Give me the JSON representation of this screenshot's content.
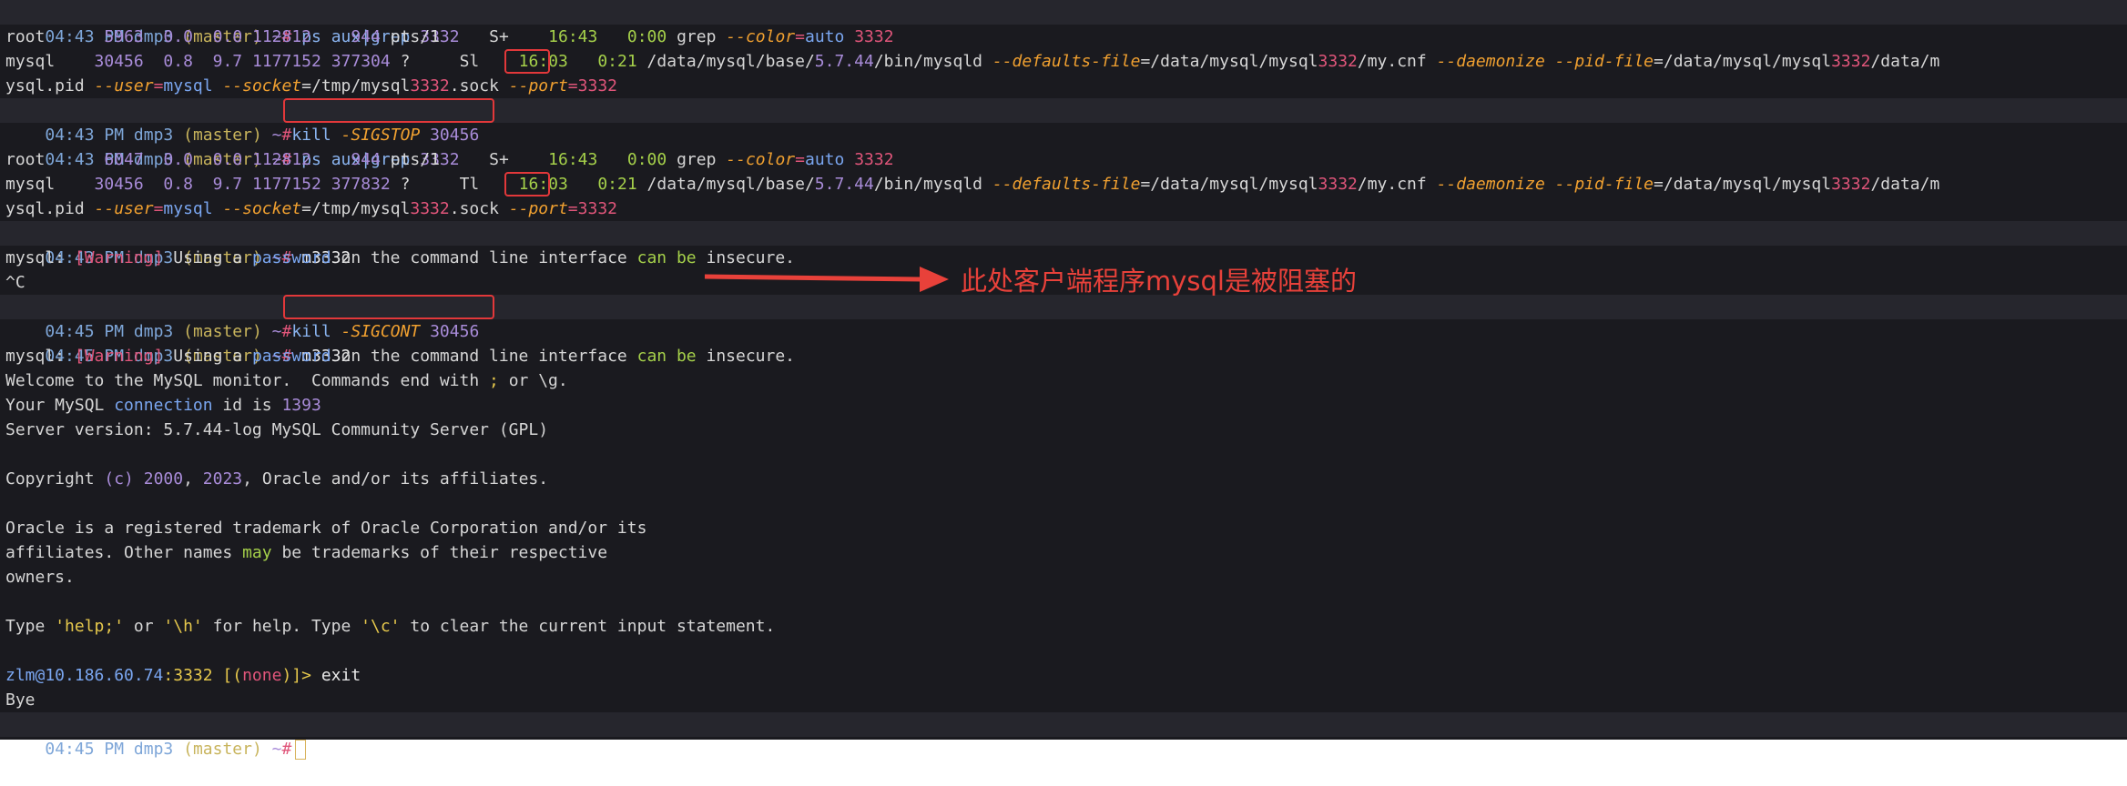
{
  "prompt": {
    "time1": "04:43 PM",
    "time2": "04:45 PM",
    "host": "dmp3",
    "branch": "(master)",
    "tilde": "~",
    "hash": "#"
  },
  "lines": {
    "l1_cmd": "ps aux|grep",
    "l1_arg": "3332",
    "l2": {
      "user": "root",
      "pid": "5963",
      "cpu": "0.0",
      "mem": "0.0",
      "vsz": "112812",
      "rss": "944",
      "tty": "pts/1",
      "stat": "S+",
      "start": "16:43",
      "time": "0:00",
      "cmd": "grep",
      "opt": "--color",
      "eq": "=",
      "val": "auto",
      "arg": "3332"
    },
    "l3": {
      "user": "mysql",
      "pid": "30456",
      "cpu": "0.8",
      "mem": "9.7",
      "vsz": "1177152",
      "rss": "377304",
      "tty": "?",
      "stat": "Sl",
      "start": "16:03",
      "time": "0:21",
      "path1": "/data/mysql/base/",
      "ver": "5.7.44",
      "path2": "/bin/mysqld",
      "opt1": "--defaults-file",
      "p3": "=/data/mysql/mysql",
      "n1": "3332",
      "p4": "/my.cnf",
      "opt2": "--daemonize",
      "opt3": "--pid-file",
      "p5": "=/data/mysql/mysql",
      "n2": "3332",
      "p6": "/data/m"
    },
    "l4": {
      "p1": "ysql.pid",
      "opt1": "--user",
      "v1": "mysql",
      "opt2": "--socket",
      "p2": "=/tmp/mysql",
      "n1": "3332",
      "p3": ".sock",
      "opt3": "--port",
      "v2": "3332"
    },
    "l5_cmd": "kill",
    "l5_opt": "-SIGSTOP",
    "l5_num": "30456",
    "l6_cmd": "ps aux|grep",
    "l6_arg": "3332",
    "l7": {
      "user": "root",
      "pid": "6047",
      "cpu": "0.0",
      "mem": "0.0",
      "vsz": "112812",
      "rss": "944",
      "tty": "pts/1",
      "stat": "S+",
      "start": "16:43",
      "time": "0:00",
      "cmd": "grep",
      "opt": "--color",
      "eq": "=",
      "val": "auto",
      "arg": "3332"
    },
    "l8": {
      "user": "mysql",
      "pid": "30456",
      "cpu": "0.8",
      "mem": "9.7",
      "vsz": "1177152",
      "rss": "377832",
      "tty": "?",
      "stat": "Tl",
      "start": "16:03",
      "time": "0:21"
    },
    "l10_cmd": "m3332",
    "warn": {
      "pre": "mysql: ",
      "tag": "[Warning]",
      "a": " Using a ",
      "b": "password",
      "c": " on the command line interface ",
      "d": "can be",
      "e": " insecure."
    },
    "l12": "^C",
    "l13_cmd": "kill",
    "l13_opt": "-SIGCONT",
    "l13_num": "30456",
    "l14_cmd": "m3332",
    "welcome": {
      "a": "Welcome to the MySQL monitor.  Commands end with ",
      "b": ";",
      "c": " or \\g."
    },
    "connid": {
      "a": "Your MySQL ",
      "b": "connection",
      "c": " id is ",
      "d": "1393"
    },
    "server": {
      "a": "Server version: 5.7.44-log MySQL Community Server (GPL)"
    },
    "copyright": {
      "a": "Copyright ",
      "b": "(c)",
      "c": " ",
      "d": "2000",
      "e": ", ",
      "f": "2023",
      "g": ", Oracle and/or its affiliates."
    },
    "trade1": "Oracle is a registered trademark of Oracle Corporation and/or its",
    "trade2": {
      "a": "affiliates. Other names ",
      "b": "may",
      "c": " be trademarks of their respective"
    },
    "trade3": "owners.",
    "help": {
      "a": "Type ",
      "b": "'help;'",
      "c": " or ",
      "d": "'\\h'",
      "e": " for help. Type ",
      "f": "'\\c'",
      "g": " to clear the current input statement."
    },
    "mysqlprompt": {
      "a": "zlm@10.186.60.74",
      "b": ":3332",
      "c": " [(",
      "d": "none",
      "e": ")]> ",
      "f": "exit"
    },
    "bye": "Bye"
  },
  "annotation": "此处客户端程序mysql是被阻塞的",
  "colors": {
    "accent_red": "#e2383a",
    "background": "#1a1a1f"
  }
}
